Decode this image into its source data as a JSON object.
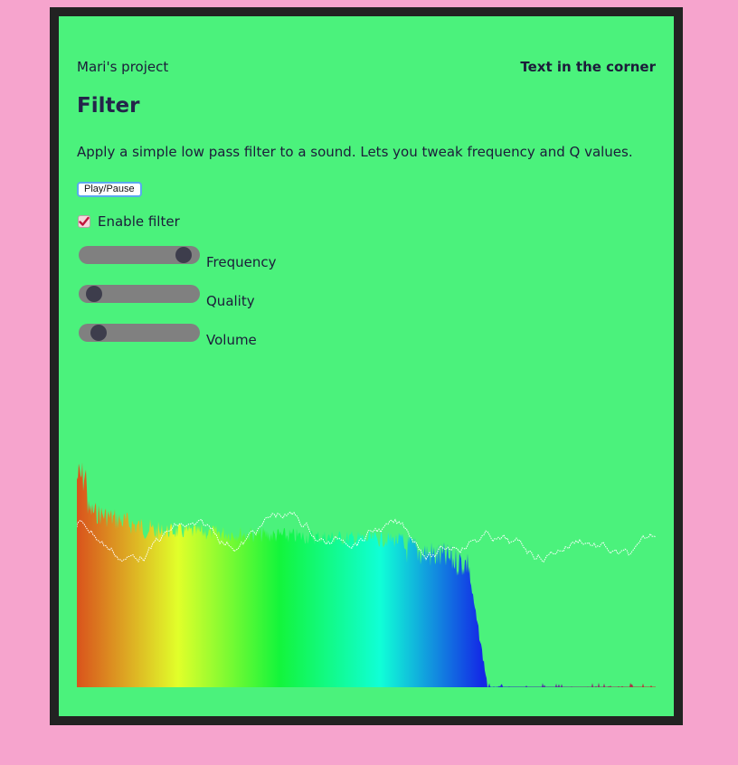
{
  "header": {
    "project_name": "Mari's project",
    "corner_text": "Text in the corner"
  },
  "main": {
    "title": "Filter",
    "description": "Apply a simple low pass filter to a sound. Lets you tweak frequency and Q values.",
    "play_pause_label": "Play/Pause",
    "enable_filter": {
      "label": "Enable filter",
      "checked": true
    },
    "sliders": [
      {
        "label": "Frequency",
        "value_fraction": 0.94
      },
      {
        "label": "Quality",
        "value_fraction": 0.05
      },
      {
        "label": "Volume",
        "value_fraction": 0.1
      }
    ]
  },
  "colors": {
    "page_background": "#f6a4cd",
    "frame": "#222222",
    "panel": "#4bf27c",
    "slider_track": "#808080",
    "slider_thumb": "#3d3d4c",
    "waveform": "#ffffff"
  },
  "visualizer": {
    "spectrum_gradient": [
      "#d9531c",
      "#e1ff2a",
      "#13f53b",
      "#10ffd7",
      "#1329e6"
    ]
  }
}
